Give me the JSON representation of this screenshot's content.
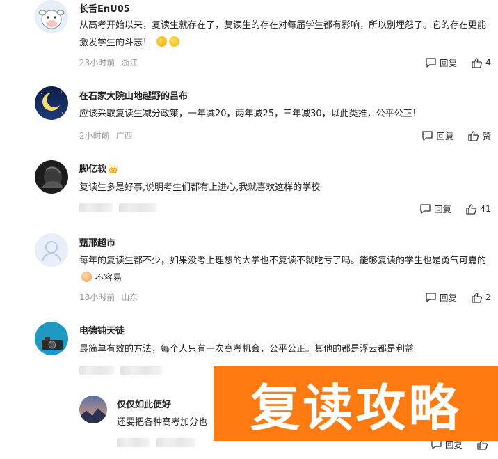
{
  "comments": [
    {
      "user": "长舌EnU05",
      "text": "从高考开始以来，复读生就存在了，复读生的存在对每届学生都有影响，所以别埋怨了。它的存在更能激发学生的斗志！",
      "time": "23小时前",
      "location": "浙江",
      "reply": "回复",
      "likes": "4"
    },
    {
      "user": "在石家大院山地越野的吕布",
      "text": "应该采取复读生减分政策，一年减20，两年减25，三年减30，以此类推，公平公正！",
      "time": "2小时前",
      "location": "广西",
      "reply": "回复",
      "likes": "赞"
    },
    {
      "user": "脚亿软",
      "badge": "👑",
      "text": "复读生多是好事,说明考生们都有上进心,我就喜欢这样的学校",
      "reply": "回复",
      "likes": "41"
    },
    {
      "user": "甄邢超市",
      "text": "每年的复读生都不少，如果没考上理想的大学也不复读不就吃亏了吗。能够复读的学生也是勇气可嘉的",
      "text_after_emoji": "不容易",
      "time": "18小时前",
      "location": "山东",
      "reply": "回复",
      "likes": "2"
    },
    {
      "user": "电德钝天徒",
      "text": "最简单有效的方法，每个人只有一次高考机会，公平公正。其他的都是浮云都是利益"
    },
    {
      "user": "仅仅如此便好",
      "text": "还要把各种高考加分也",
      "reply": "回复"
    }
  ],
  "overlay": {
    "text": "复读攻略"
  },
  "colors": {
    "overlay_bg": "#ff7a10",
    "meta": "#999999"
  }
}
